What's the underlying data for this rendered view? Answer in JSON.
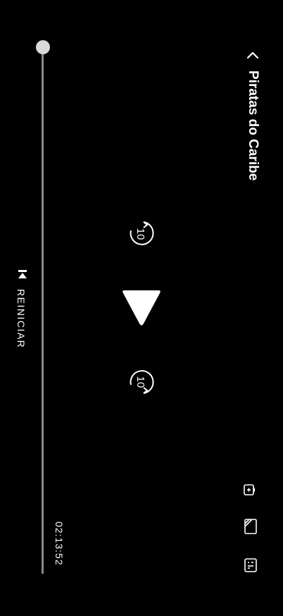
{
  "header": {
    "title": "Piratas do Caribe",
    "back_icon": "chevron-left-icon"
  },
  "controls": {
    "skip_back_seconds": "10",
    "skip_forward_seconds": "10",
    "play_icon": "play-icon",
    "restart_label": "REINICIAR"
  },
  "side_icons": [
    "lock-icon",
    "aspect-ratio-icon",
    "subtitles-icon"
  ],
  "progress": {
    "position_fraction": 0.0,
    "remaining_time": "02:13:52"
  }
}
